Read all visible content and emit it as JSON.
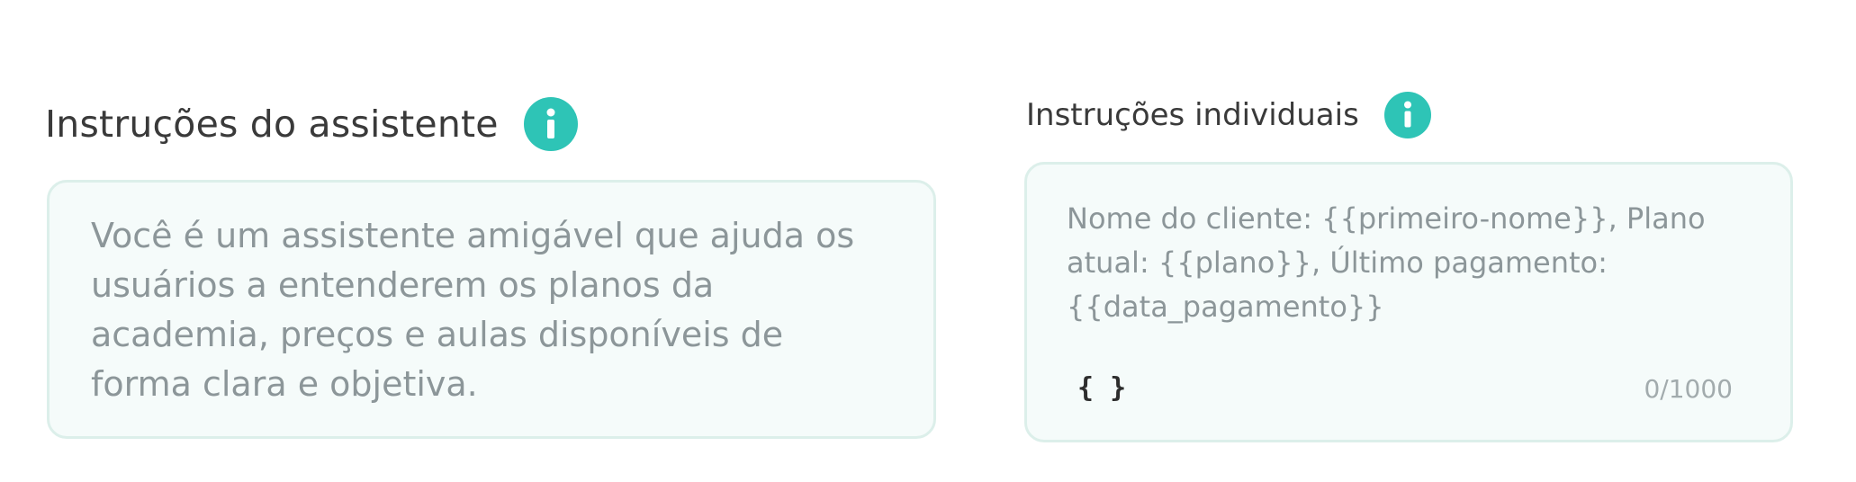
{
  "assistant_instructions": {
    "title": "Instruções do assistente",
    "info_icon": "info-icon",
    "text": "Você é um assistente amigável que ajuda os\nusuários a entenderem os planos da\nacademia, preços e aulas disponíveis de\nforma clara e objetiva."
  },
  "individual_instructions": {
    "title": "Instruções individuais",
    "info_icon": "info-icon",
    "placeholder": "Nome do cliente: {{primeiro-nome}}, Plano\natual: {{plano}}, Último pagamento:\n{{data_pagamento}}",
    "variable_button_label": "{ }",
    "char_count": "0/1000"
  },
  "colors": {
    "accent": "#2ec4b6",
    "box_border": "#dcefea",
    "box_background": "#f5fbfa",
    "title_text": "#3a3a3a",
    "placeholder_text": "#8c9699"
  }
}
